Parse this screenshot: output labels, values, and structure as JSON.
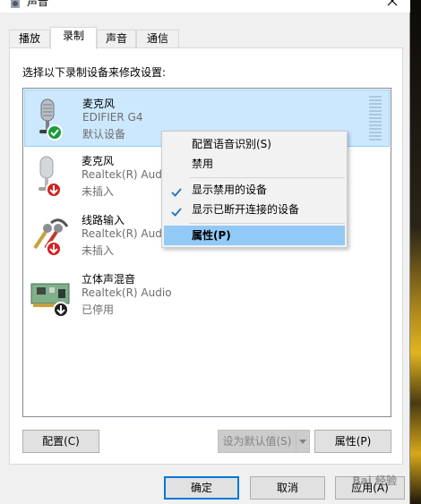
{
  "window": {
    "title": "声音"
  },
  "tabs": [
    {
      "label": "播放"
    },
    {
      "label": "录制"
    },
    {
      "label": "声音"
    },
    {
      "label": "通信"
    }
  ],
  "page": {
    "instruction": "选择以下录制设备来修改设置:"
  },
  "devices": [
    {
      "name": "麦克风",
      "driver": "EDIFIER G4",
      "status": "默认设备",
      "state": "default"
    },
    {
      "name": "麦克风",
      "driver": "Realtek(R) Audio",
      "status": "未插入",
      "state": "unplugged"
    },
    {
      "name": "线路输入",
      "driver": "Realtek(R) Audio",
      "status": "未插入",
      "state": "unplugged"
    },
    {
      "name": "立体声混音",
      "driver": "Realtek(R) Audio",
      "status": "已停用",
      "state": "disabled"
    }
  ],
  "context_menu": {
    "items": [
      {
        "label": "配置语音识别(S)"
      },
      {
        "label": "禁用"
      },
      {
        "label": "显示禁用的设备",
        "checked": true
      },
      {
        "label": "显示已断开连接的设备",
        "checked": true
      },
      {
        "label": "属性(P)"
      }
    ]
  },
  "buttons": {
    "configure": "配置(C)",
    "set_default": "设为默认值(S)",
    "properties": "属性(P)",
    "ok": "确定",
    "cancel": "取消",
    "apply": "应用(A)"
  },
  "watermark": "Bai 经验",
  "colors": {
    "selection": "#cce8ff",
    "menu_hover": "#91c9f7",
    "accent": "#0078d7",
    "default_badge": "#1a9b3c",
    "unplugged_badge": "#d32020"
  }
}
